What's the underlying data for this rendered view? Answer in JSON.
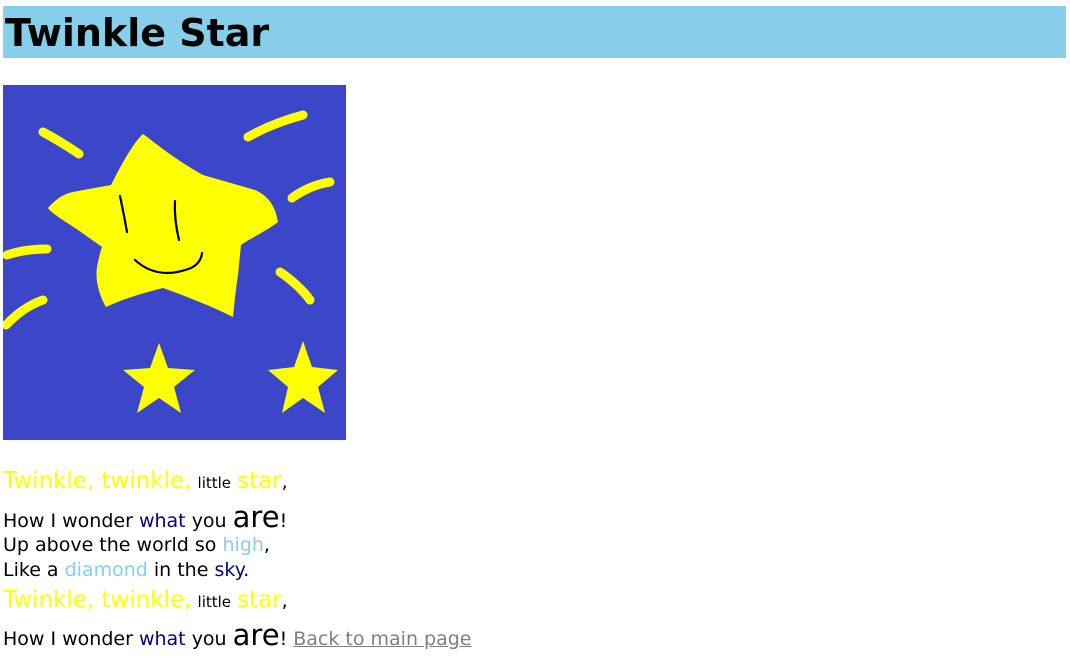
{
  "header": {
    "title": "Twinkle Star"
  },
  "image": {
    "icon": "smiling-star-drawing",
    "colors": {
      "sky": "#3c46c8",
      "star": "#ffff00",
      "face": "#000000"
    }
  },
  "poem": {
    "line1": {
      "w1": "Twinkle, twinkle,",
      "w2": "little",
      "w3": "star",
      "w4": ","
    },
    "line2": {
      "w1": "How I wonder",
      "w2": "what",
      "w3": "you",
      "w4": "are",
      "w5": "!"
    },
    "line3": {
      "w1": "Up above the world so",
      "w2": "high",
      "w3": ","
    },
    "line4": {
      "w1": "Like a",
      "w2": "diamond",
      "w3": "in the",
      "w4": "sky",
      "w5": "."
    },
    "line5": {
      "w1": "Twinkle, twinkle,",
      "w2": "little",
      "w3": "star",
      "w4": ","
    },
    "line6": {
      "w1": "How I wonder",
      "w2": "what",
      "w3": "you",
      "w4": "are",
      "w5": "!"
    }
  },
  "link": {
    "back_label": "Back to main page"
  },
  "colors": {
    "header_bg": "#87ceeb",
    "yellow_text": "#ffff00",
    "navy_text": "#000080",
    "skyblue_text": "#87ceeb",
    "link": "#808080"
  }
}
